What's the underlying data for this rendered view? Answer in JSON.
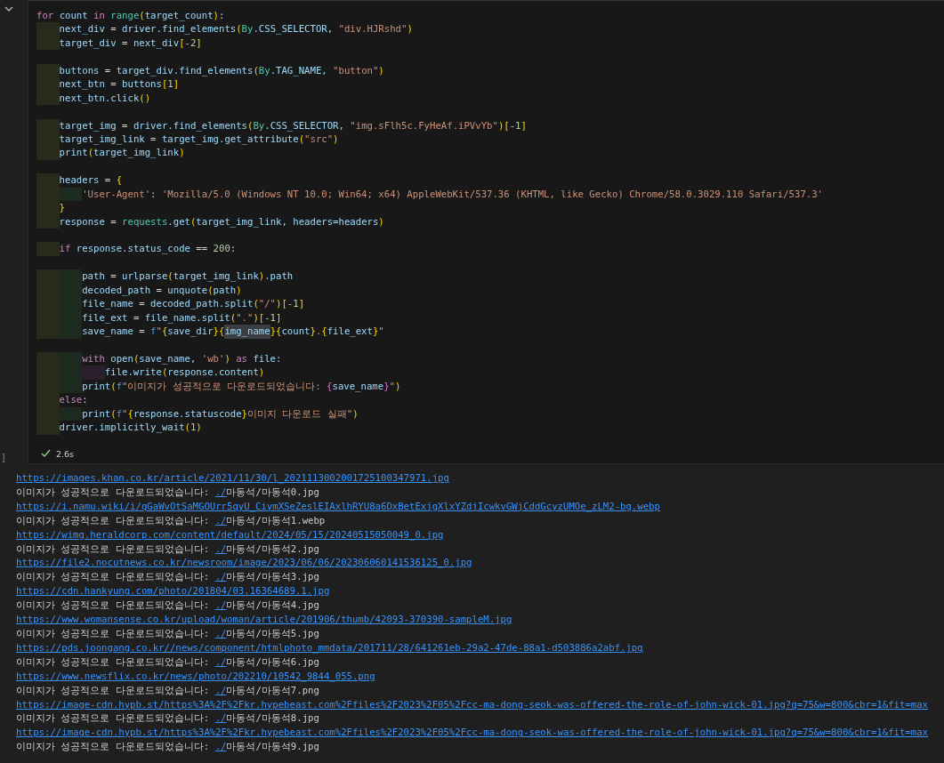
{
  "cell": {
    "collapse_toggle": true,
    "code_lines": [
      [
        {
          "kind": "k",
          "text": "for "
        },
        {
          "kind": "t",
          "text": "count "
        },
        {
          "kind": "k",
          "text": "in "
        },
        {
          "kind": "c",
          "text": "range"
        },
        {
          "kind": "b",
          "text": "("
        },
        {
          "kind": "t",
          "text": "target_count"
        },
        {
          "kind": "b",
          "text": ")"
        },
        {
          "kind": "o",
          "text": ":"
        }
      ],
      [
        {
          "kind": "i"
        },
        {
          "kind": "t",
          "text": "next_div "
        },
        {
          "kind": "o",
          "text": "= "
        },
        {
          "kind": "t",
          "text": "driver.find_elements"
        },
        {
          "kind": "b",
          "text": "("
        },
        {
          "kind": "c",
          "text": "By"
        },
        {
          "kind": "t",
          "text": ".CSS_SELECTOR, "
        },
        {
          "kind": "s",
          "text": "\"div.HJRshd\""
        },
        {
          "kind": "b",
          "text": ")"
        }
      ],
      [
        {
          "kind": "i"
        },
        {
          "kind": "t",
          "text": "target_div "
        },
        {
          "kind": "o",
          "text": "= "
        },
        {
          "kind": "t",
          "text": "next_div"
        },
        {
          "kind": "b",
          "text": "["
        },
        {
          "kind": "n",
          "text": "-2"
        },
        {
          "kind": "b",
          "text": "]"
        }
      ],
      [
        {
          "kind": "blank"
        }
      ],
      [
        {
          "kind": "i"
        },
        {
          "kind": "t",
          "text": "buttons "
        },
        {
          "kind": "o",
          "text": "= "
        },
        {
          "kind": "t",
          "text": "target_div.find_elements"
        },
        {
          "kind": "b",
          "text": "("
        },
        {
          "kind": "c",
          "text": "By"
        },
        {
          "kind": "t",
          "text": ".TAG_NAME, "
        },
        {
          "kind": "s",
          "text": "\"button\""
        },
        {
          "kind": "b",
          "text": ")"
        }
      ],
      [
        {
          "kind": "i"
        },
        {
          "kind": "t",
          "text": "next_btn "
        },
        {
          "kind": "o",
          "text": "= "
        },
        {
          "kind": "t",
          "text": "buttons"
        },
        {
          "kind": "b",
          "text": "["
        },
        {
          "kind": "n",
          "text": "1"
        },
        {
          "kind": "b",
          "text": "]"
        }
      ],
      [
        {
          "kind": "i"
        },
        {
          "kind": "t",
          "text": "next_btn.click"
        },
        {
          "kind": "b",
          "text": "()"
        }
      ],
      [
        {
          "kind": "blank"
        }
      ],
      [
        {
          "kind": "i"
        },
        {
          "kind": "t",
          "text": "target_img "
        },
        {
          "kind": "o",
          "text": "= "
        },
        {
          "kind": "t",
          "text": "driver.find_elements"
        },
        {
          "kind": "b",
          "text": "("
        },
        {
          "kind": "c",
          "text": "By"
        },
        {
          "kind": "t",
          "text": ".CSS_SELECTOR, "
        },
        {
          "kind": "s",
          "text": "\"img.sFlh5c.FyHeAf.iPVvYb\""
        },
        {
          "kind": "b",
          "text": ")["
        },
        {
          "kind": "n",
          "text": "-1"
        },
        {
          "kind": "b",
          "text": "]"
        }
      ],
      [
        {
          "kind": "i"
        },
        {
          "kind": "t",
          "text": "target_img_link "
        },
        {
          "kind": "o",
          "text": "= "
        },
        {
          "kind": "t",
          "text": "target_img.get_attribute"
        },
        {
          "kind": "b",
          "text": "("
        },
        {
          "kind": "s",
          "text": "\"src\""
        },
        {
          "kind": "b",
          "text": ")"
        }
      ],
      [
        {
          "kind": "i"
        },
        {
          "kind": "t",
          "text": "print"
        },
        {
          "kind": "b",
          "text": "("
        },
        {
          "kind": "t",
          "text": "target_img_link"
        },
        {
          "kind": "b",
          "text": ")"
        }
      ],
      [
        {
          "kind": "blank"
        }
      ],
      [
        {
          "kind": "i"
        },
        {
          "kind": "t",
          "text": "headers "
        },
        {
          "kind": "o",
          "text": "= "
        },
        {
          "kind": "b",
          "text": "{"
        }
      ],
      [
        {
          "kind": "i"
        },
        {
          "kind": "i"
        },
        {
          "kind": "s",
          "text": "'User-Agent'"
        },
        {
          "kind": "o",
          "text": ": "
        },
        {
          "kind": "s",
          "text": "'Mozilla/5.0 (Windows NT 10.0; Win64; x64) AppleWebKit/537.36 (KHTML, like Gecko) Chrome/58.0.3029.110 Safari/537.3'"
        }
      ],
      [
        {
          "kind": "i"
        },
        {
          "kind": "b",
          "text": "}"
        }
      ],
      [
        {
          "kind": "i"
        },
        {
          "kind": "t",
          "text": "response "
        },
        {
          "kind": "o",
          "text": "= "
        },
        {
          "kind": "c",
          "text": "requests"
        },
        {
          "kind": "t",
          "text": ".get"
        },
        {
          "kind": "b",
          "text": "("
        },
        {
          "kind": "t",
          "text": "target_img_link, headers=headers"
        },
        {
          "kind": "b",
          "text": ")"
        }
      ],
      [
        {
          "kind": "blank"
        }
      ],
      [
        {
          "kind": "i"
        },
        {
          "kind": "k",
          "text": "if "
        },
        {
          "kind": "t",
          "text": "response.status_code "
        },
        {
          "kind": "o",
          "text": "== "
        },
        {
          "kind": "n",
          "text": "200"
        },
        {
          "kind": "o",
          "text": ":"
        }
      ],
      [
        {
          "kind": "blank"
        }
      ],
      [
        {
          "kind": "i"
        },
        {
          "kind": "i"
        },
        {
          "kind": "t",
          "text": "path "
        },
        {
          "kind": "o",
          "text": "= "
        },
        {
          "kind": "t",
          "text": "urlparse"
        },
        {
          "kind": "b",
          "text": "("
        },
        {
          "kind": "t",
          "text": "target_img_link"
        },
        {
          "kind": "b",
          "text": ")"
        },
        {
          "kind": "t",
          "text": ".path"
        }
      ],
      [
        {
          "kind": "i"
        },
        {
          "kind": "i"
        },
        {
          "kind": "t",
          "text": "decoded_path "
        },
        {
          "kind": "o",
          "text": "= "
        },
        {
          "kind": "t",
          "text": "unquote"
        },
        {
          "kind": "b",
          "text": "("
        },
        {
          "kind": "t",
          "text": "path"
        },
        {
          "kind": "b",
          "text": ")"
        }
      ],
      [
        {
          "kind": "i"
        },
        {
          "kind": "i"
        },
        {
          "kind": "t",
          "text": "file_name "
        },
        {
          "kind": "o",
          "text": "= "
        },
        {
          "kind": "t",
          "text": "decoded_path.split"
        },
        {
          "kind": "b",
          "text": "("
        },
        {
          "kind": "s",
          "text": "\"/\""
        },
        {
          "kind": "b",
          "text": ")["
        },
        {
          "kind": "n",
          "text": "-1"
        },
        {
          "kind": "b",
          "text": "]"
        }
      ],
      [
        {
          "kind": "i"
        },
        {
          "kind": "i"
        },
        {
          "kind": "t",
          "text": "file_ext "
        },
        {
          "kind": "o",
          "text": "= "
        },
        {
          "kind": "t",
          "text": "file_name.split"
        },
        {
          "kind": "b",
          "text": "("
        },
        {
          "kind": "s",
          "text": "\".\""
        },
        {
          "kind": "b",
          "text": ")["
        },
        {
          "kind": "n",
          "text": "-1"
        },
        {
          "kind": "b",
          "text": "]"
        }
      ],
      [
        {
          "kind": "i"
        },
        {
          "kind": "i"
        },
        {
          "kind": "t",
          "text": "save_name "
        },
        {
          "kind": "o",
          "text": "= "
        },
        {
          "kind": "f",
          "text": "f"
        },
        {
          "kind": "s",
          "text": "\""
        },
        {
          "kind": "b",
          "text": "{"
        },
        {
          "kind": "t",
          "text": "save_dir"
        },
        {
          "kind": "b",
          "text": "}{"
        },
        {
          "kind": "h",
          "text": "img_name"
        },
        {
          "kind": "b",
          "text": "}{"
        },
        {
          "kind": "t",
          "text": "count"
        },
        {
          "kind": "b",
          "text": "}"
        },
        {
          "kind": "s",
          "text": "."
        },
        {
          "kind": "b",
          "text": "{"
        },
        {
          "kind": "t",
          "text": "file_ext"
        },
        {
          "kind": "b",
          "text": "}"
        },
        {
          "kind": "s",
          "text": "\""
        }
      ],
      [
        {
          "kind": "blank"
        }
      ],
      [
        {
          "kind": "i"
        },
        {
          "kind": "i"
        },
        {
          "kind": "k",
          "text": "with "
        },
        {
          "kind": "t",
          "text": "open"
        },
        {
          "kind": "b",
          "text": "("
        },
        {
          "kind": "t",
          "text": "save_name, "
        },
        {
          "kind": "s",
          "text": "'wb'"
        },
        {
          "kind": "b",
          "text": ")"
        },
        {
          "kind": "k",
          "text": " as "
        },
        {
          "kind": "t",
          "text": "file:"
        }
      ],
      [
        {
          "kind": "i"
        },
        {
          "kind": "i"
        },
        {
          "kind": "i"
        },
        {
          "kind": "t",
          "text": "file.write"
        },
        {
          "kind": "b",
          "text": "("
        },
        {
          "kind": "t",
          "text": "response.content"
        },
        {
          "kind": "b",
          "text": ")"
        }
      ],
      [
        {
          "kind": "i"
        },
        {
          "kind": "i"
        },
        {
          "kind": "t",
          "text": "print"
        },
        {
          "kind": "b",
          "text": "("
        },
        {
          "kind": "f",
          "text": "f"
        },
        {
          "kind": "s",
          "text": "\"이미지가 성공적으로 다운로드되었습니다: "
        },
        {
          "kind": "p",
          "text": "{"
        },
        {
          "kind": "t",
          "text": "save_name"
        },
        {
          "kind": "p",
          "text": "}"
        },
        {
          "kind": "s",
          "text": "\""
        },
        {
          "kind": "b",
          "text": ")"
        }
      ],
      [
        {
          "kind": "i"
        },
        {
          "kind": "k",
          "text": "else"
        },
        {
          "kind": "o",
          "text": ":"
        }
      ],
      [
        {
          "kind": "i"
        },
        {
          "kind": "i"
        },
        {
          "kind": "t",
          "text": "print"
        },
        {
          "kind": "b",
          "text": "("
        },
        {
          "kind": "f",
          "text": "f"
        },
        {
          "kind": "s",
          "text": "\""
        },
        {
          "kind": "b",
          "text": "{"
        },
        {
          "kind": "t",
          "text": "response.statuscode"
        },
        {
          "kind": "b",
          "text": "}"
        },
        {
          "kind": "s",
          "text": "이미지 다운로드 실패\""
        },
        {
          "kind": "b",
          "text": ")"
        }
      ],
      [
        {
          "kind": "i"
        },
        {
          "kind": "t",
          "text": "driver.implicitly_wait"
        },
        {
          "kind": "b",
          "text": "("
        },
        {
          "kind": "n",
          "text": "1"
        },
        {
          "kind": "b",
          "text": ")"
        }
      ]
    ],
    "execution": {
      "bracket": "]",
      "succeeded": true,
      "duration": "2.6s"
    }
  },
  "output": [
    {
      "kind": "url",
      "text": "https://images.khan.co.kr/article/2021/11/30/l_2021113002001725100347971.jpg"
    },
    {
      "kind": "message",
      "text": "이미지가 성공적으로 다운로드되었습니다: ",
      "link": "./",
      "rest": "마동석/마동석0.jpg"
    },
    {
      "kind": "url",
      "text": "https://i.namu.wiki/i/qGaWvOtSaMGOUrr5qyU_CiymXSeZeslEIAxlhRYU8a6DxBetExjgXlxYZdjIcwkvGWjCddGcyzUMOe_zLM2-bg.webp"
    },
    {
      "kind": "message",
      "text": "이미지가 성공적으로 다운로드되었습니다: ",
      "link": "./",
      "rest": "마동석/마동석1.webp"
    },
    {
      "kind": "url",
      "text": "https://wimg.heraldcorp.com/content/default/2024/05/15/20240515050049_0.jpg"
    },
    {
      "kind": "message",
      "text": "이미지가 성공적으로 다운로드되었습니다: ",
      "link": "./",
      "rest": "마동석/마동석2.jpg"
    },
    {
      "kind": "url",
      "text": "https://file2.nocutnews.co.kr/newsroom/image/2023/06/06/202306060141536125_0.jpg"
    },
    {
      "kind": "message",
      "text": "이미지가 성공적으로 다운로드되었습니다: ",
      "link": "./",
      "rest": "마동석/마동석3.jpg"
    },
    {
      "kind": "url",
      "text": "https://cdn.hankyung.com/photo/201804/03.16364689.1.jpg"
    },
    {
      "kind": "message",
      "text": "이미지가 성공적으로 다운로드되었습니다: ",
      "link": "./",
      "rest": "마동석/마동석4.jpg"
    },
    {
      "kind": "url",
      "text": "https://www.womansense.co.kr/upload/woman/article/201906/thumb/42093-370390-sampleM.jpg"
    },
    {
      "kind": "message",
      "text": "이미지가 성공적으로 다운로드되었습니다: ",
      "link": "./",
      "rest": "마동석/마동석5.jpg"
    },
    {
      "kind": "url",
      "text": "https://pds.joongang.co.kr//news/component/htmlphoto_mmdata/201711/28/641261eb-29a2-47de-88a1-d503886a2abf.jpg"
    },
    {
      "kind": "message",
      "text": "이미지가 성공적으로 다운로드되었습니다: ",
      "link": "./",
      "rest": "마동석/마동석6.jpg"
    },
    {
      "kind": "url",
      "text": "https://www.newsflix.co.kr/news/photo/202210/10542_9844_055.png"
    },
    {
      "kind": "message",
      "text": "이미지가 성공적으로 다운로드되었습니다: ",
      "link": "./",
      "rest": "마동석/마동석7.png"
    },
    {
      "kind": "url",
      "text": "https://image-cdn.hypb.st/https%3A%2F%2Fkr.hypebeast.com%2Ffiles%2F2023%2F05%2Fcc-ma-dong-seok-was-offered-the-role-of-john-wick-01.jpg?q=75&w=800&cbr=1&fit=max"
    },
    {
      "kind": "message",
      "text": "이미지가 성공적으로 다운로드되었습니다: ",
      "link": "./",
      "rest": "마동석/마동석8.jpg"
    },
    {
      "kind": "url",
      "text": "https://image-cdn.hypb.st/https%3A%2F%2Fkr.hypebeast.com%2Ffiles%2F2023%2F05%2Fcc-ma-dong-seok-was-offered-the-role-of-john-wick-01.jpg?q=75&w=800&cbr=1&fit=max"
    },
    {
      "kind": "message",
      "text": "이미지가 성공적으로 다운로드되었습니다: ",
      "link": "./",
      "rest": "마동석/마동석9.jpg"
    }
  ]
}
